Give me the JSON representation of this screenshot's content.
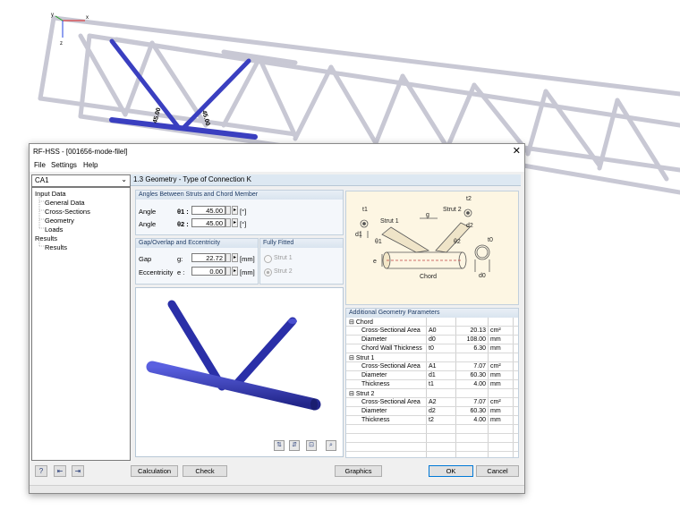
{
  "window": {
    "title": "RF-HSS - [001656-mode-filel]",
    "close_glyph": "✕",
    "menu": [
      "File",
      "Settings",
      "Help"
    ]
  },
  "scene": {
    "angle_label_1": "45.00",
    "angle_label_2": "45.00",
    "axis_labels": {
      "x": "x",
      "y": "y",
      "z": "z"
    }
  },
  "case_selector": {
    "value": "CA1"
  },
  "nav_tree": [
    {
      "label": "Input Data"
    },
    {
      "label": "General Data"
    },
    {
      "label": "Cross-Sections"
    },
    {
      "label": "Geometry"
    },
    {
      "label": "Loads"
    },
    {
      "label": "Results"
    },
    {
      "label": "Results"
    }
  ],
  "pane": {
    "title": "1.3 Geometry - Type of Connection K"
  },
  "angles": {
    "title": "Angles Between Struts and Chord Member",
    "rows": [
      {
        "label": "Angle",
        "symbol": "θ1 :",
        "value": "45.00",
        "unit": "[°]"
      },
      {
        "label": "Angle",
        "symbol": "θ2 :",
        "value": "45.00",
        "unit": "[°]"
      }
    ]
  },
  "gap": {
    "title": "Gap/Overlap and Eccentricity",
    "rows": [
      {
        "label": "Gap",
        "symbol": "g:",
        "value": "22.72",
        "unit": "[mm]"
      },
      {
        "label": "Eccentricity",
        "symbol": "e :",
        "value": "0.00",
        "unit": "[mm]"
      }
    ]
  },
  "fitted": {
    "title": "Fully Fitted",
    "options": [
      "Strut 1",
      "Strut 2"
    ],
    "selected": "Strut 2"
  },
  "diagram": {
    "labels": {
      "t1": "t1",
      "d1": "d1",
      "strut1": "Strut 1",
      "strut2": "Strut 2",
      "g": "g",
      "t2": "t2",
      "d2": "d2",
      "e": "e",
      "t0": "t0",
      "chord": "Chord",
      "d0": "d0",
      "theta1": "θ1",
      "theta2": "θ2"
    }
  },
  "params": {
    "title": "Additional Geometry Parameters",
    "groups": [
      {
        "name": "Chord",
        "rows": [
          {
            "name": "Cross-Sectional Area",
            "symbol": "A0",
            "value": "20.13",
            "unit": "cm²"
          },
          {
            "name": "Diameter",
            "symbol": "d0",
            "value": "108.00",
            "unit": "mm"
          },
          {
            "name": "Chord Wall Thickness",
            "symbol": "t0",
            "value": "6.30",
            "unit": "mm"
          }
        ]
      },
      {
        "name": "Strut 1",
        "rows": [
          {
            "name": "Cross-Sectional Area",
            "symbol": "A1",
            "value": "7.07",
            "unit": "cm²"
          },
          {
            "name": "Diameter",
            "symbol": "d1",
            "value": "60.30",
            "unit": "mm"
          },
          {
            "name": "Thickness",
            "symbol": "t1",
            "value": "4.00",
            "unit": "mm"
          }
        ]
      },
      {
        "name": "Strut 2",
        "rows": [
          {
            "name": "Cross-Sectional Area",
            "symbol": "A2",
            "value": "7.07",
            "unit": "cm²"
          },
          {
            "name": "Diameter",
            "symbol": "d2",
            "value": "60.30",
            "unit": "mm"
          },
          {
            "name": "Thickness",
            "symbol": "t2",
            "value": "4.00",
            "unit": "mm"
          }
        ]
      }
    ]
  },
  "buttons": {
    "calculation": "Calculation",
    "check": "Check",
    "graphics": "Graphics",
    "ok": "OK",
    "cancel": "Cancel"
  },
  "colors": {
    "member_blue": "#3a3fc0",
    "truss_grey": "#c8c8d4",
    "header_blue": "#dde8f2"
  }
}
